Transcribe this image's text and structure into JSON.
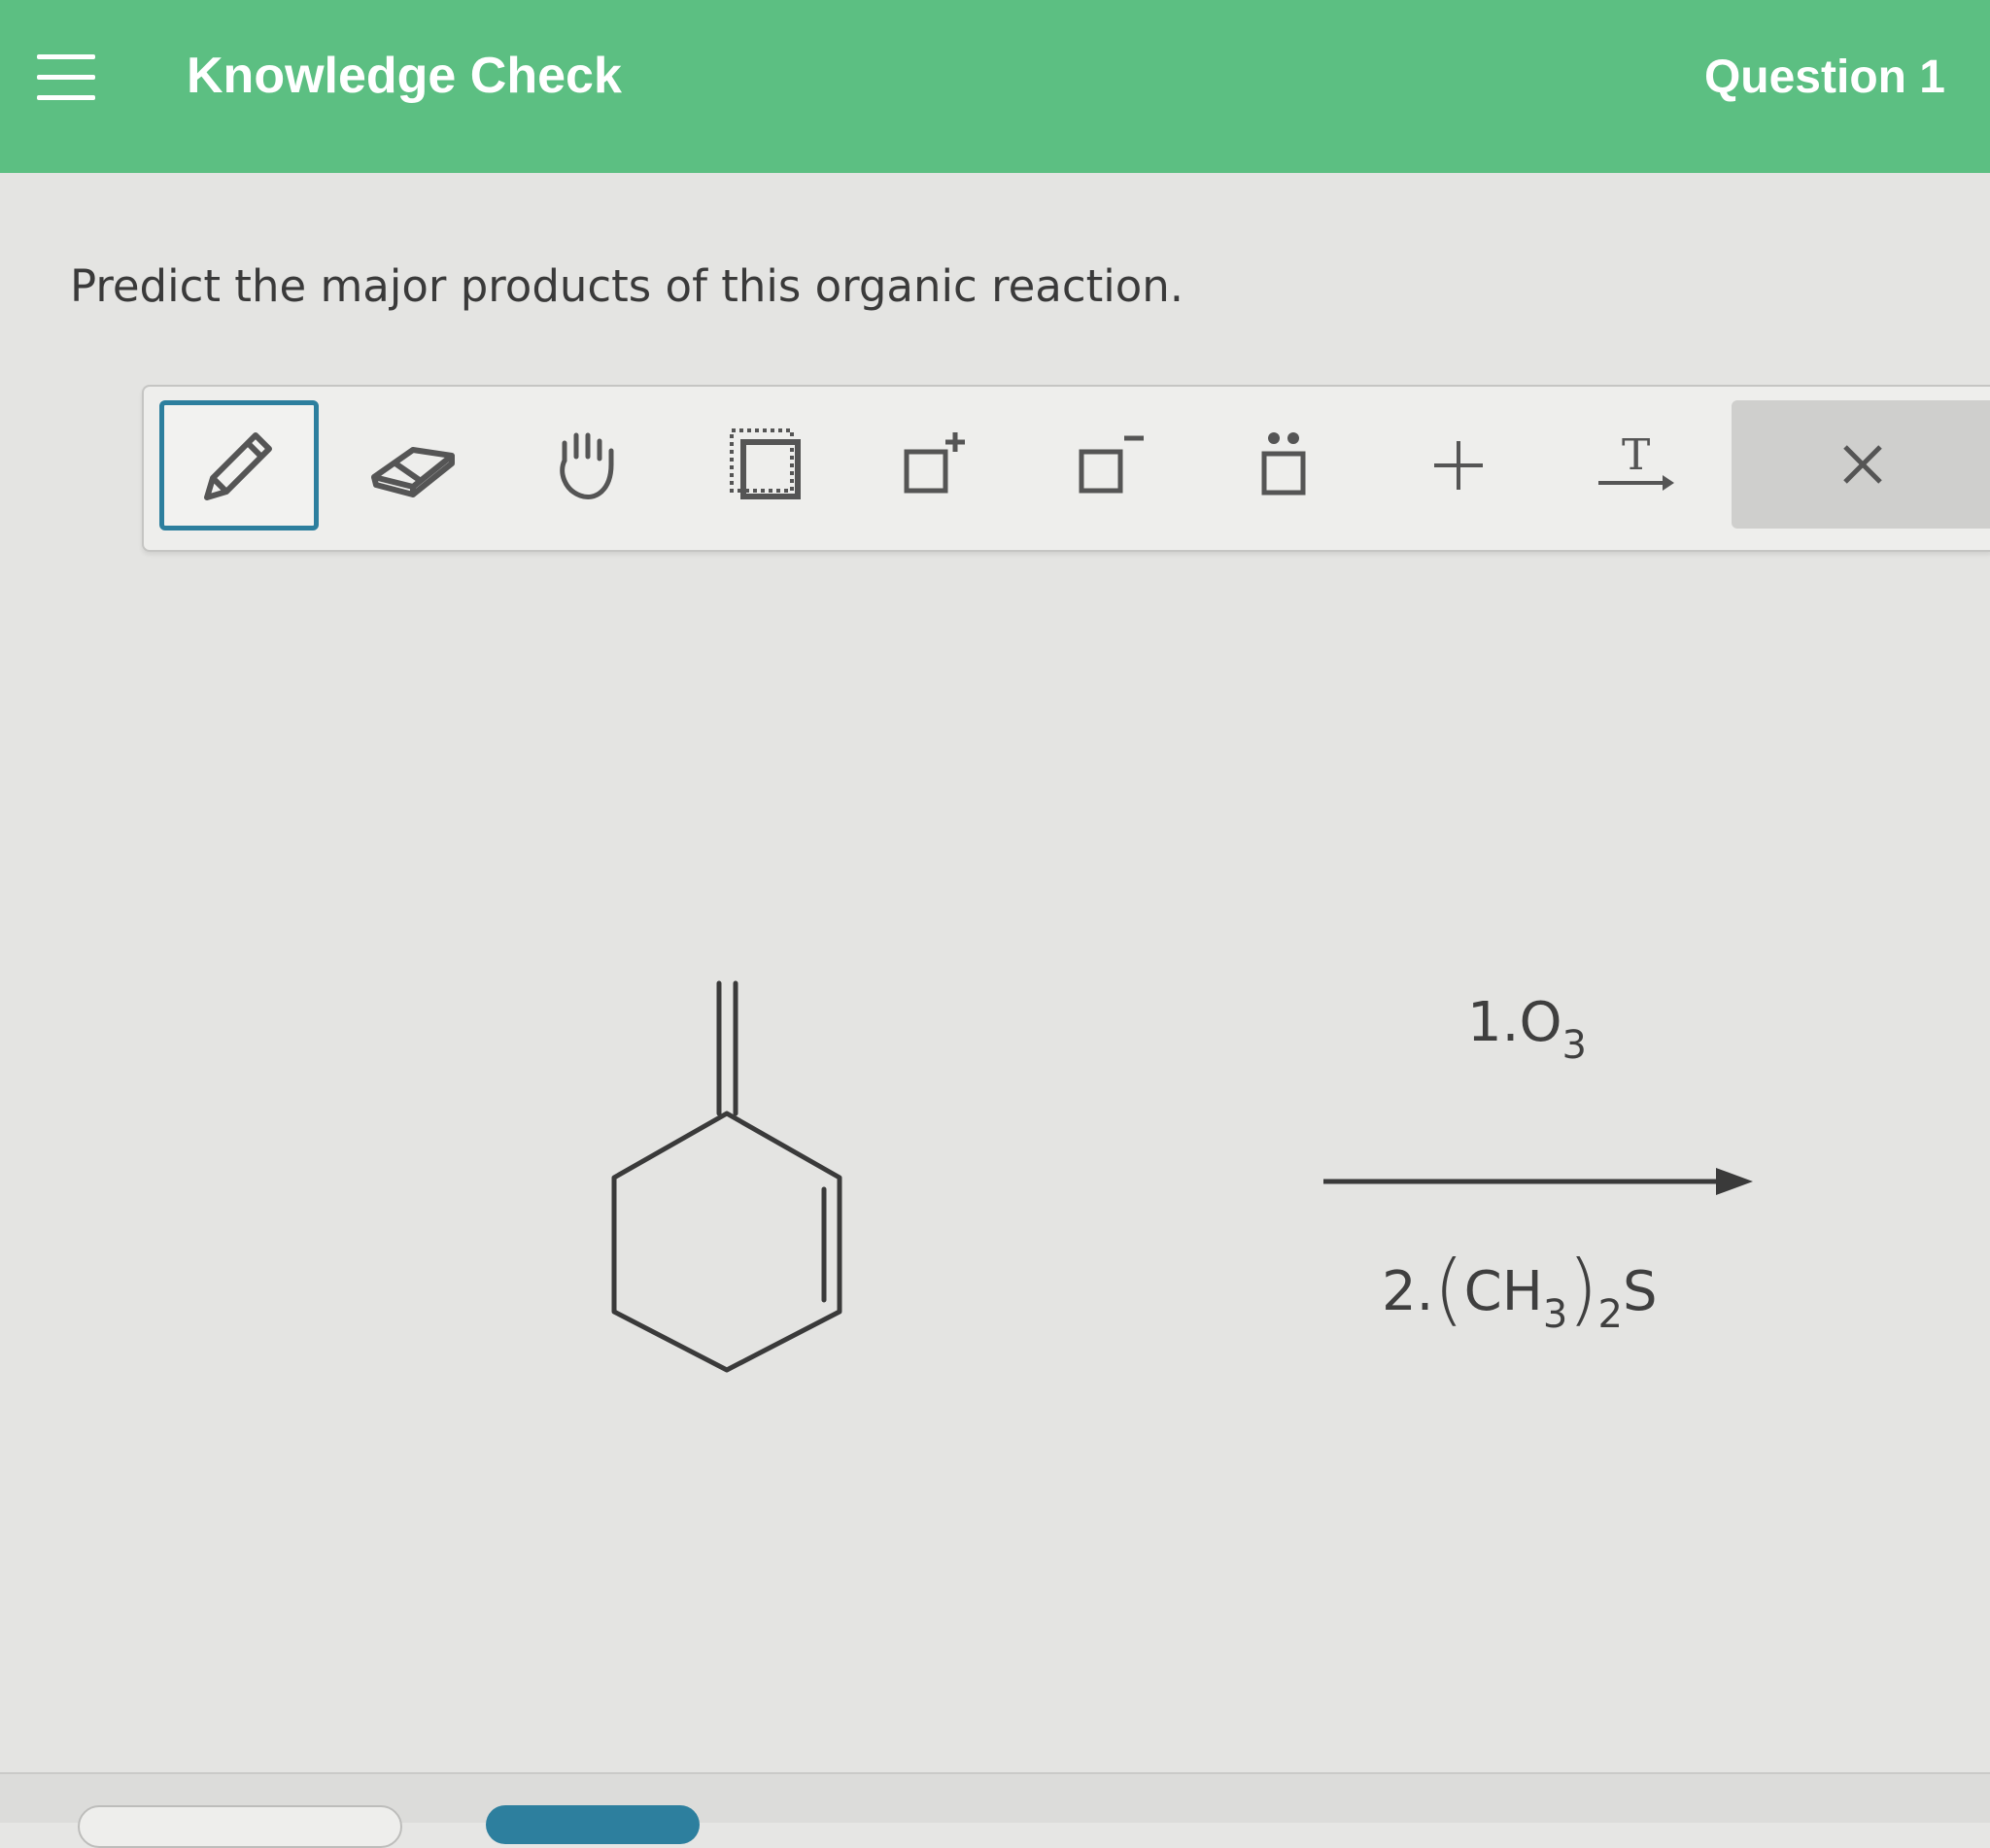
{
  "header": {
    "title": "Knowledge Check",
    "question_label": "Question 1",
    "menu_icon": "hamburger-menu-icon"
  },
  "prompt": "Predict the major products of this organic reaction.",
  "toolbar": {
    "tools": [
      {
        "name": "pencil-tool",
        "icon": "pencil-icon",
        "selected": true
      },
      {
        "name": "eraser-tool",
        "icon": "eraser-icon",
        "selected": false
      },
      {
        "name": "hand-tool",
        "icon": "hand-icon",
        "selected": false
      },
      {
        "name": "select-tool",
        "icon": "dotted-select-icon",
        "selected": false
      },
      {
        "name": "positive-charge-tool",
        "icon": "box-plus-icon",
        "selected": false
      },
      {
        "name": "negative-charge-tool",
        "icon": "box-minus-icon",
        "selected": false
      },
      {
        "name": "lone-pair-tool",
        "icon": "box-dots-icon",
        "selected": false
      },
      {
        "name": "add-tool",
        "icon": "plus-icon",
        "label": "+",
        "selected": false
      },
      {
        "name": "text-arrow-tool",
        "icon": "text-arrow-icon",
        "label": "T",
        "selected": false
      },
      {
        "name": "clear-tool",
        "icon": "close-icon",
        "label": "×",
        "selected": false
      }
    ],
    "accent_color": "#2d7f9e"
  },
  "reaction": {
    "reagent_step1": {
      "prefix": "1.",
      "species": "O",
      "subscript": "3"
    },
    "reagent_step2": {
      "prefix": "2.",
      "open": "(",
      "group": "CH",
      "group_sub": "3",
      "close": ")",
      "count_sub": "2",
      "element": "S"
    }
  },
  "colors": {
    "header_green": "#5cbf82",
    "background": "#e4e4e2"
  }
}
